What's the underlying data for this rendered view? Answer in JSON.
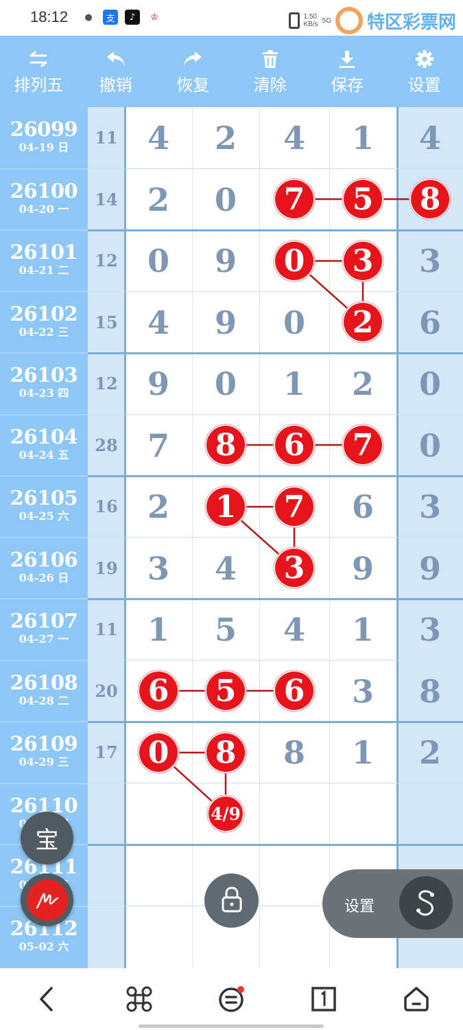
{
  "status_bar": {
    "time": "18:12",
    "speed_top": "1.50",
    "speed_unit": "KB/s",
    "network": "5G",
    "watermark": "特区彩票网"
  },
  "toolbar": {
    "items": [
      {
        "label": "排列五",
        "icon": "swap-arrows-icon"
      },
      {
        "label": "撤销",
        "icon": "undo-arrow-icon"
      },
      {
        "label": "恢复",
        "icon": "redo-arrow-icon"
      },
      {
        "label": "清除",
        "icon": "trash-icon"
      },
      {
        "label": "保存",
        "icon": "download-icon"
      },
      {
        "label": "设置",
        "icon": "gear-icon"
      }
    ]
  },
  "rows": [
    {
      "issue": "26099",
      "date": "04-19 日",
      "sum": "11",
      "digits": [
        "4",
        "2",
        "4",
        "1",
        "4"
      ]
    },
    {
      "issue": "26100",
      "date": "04-20 一",
      "sum": "14",
      "digits": [
        "2",
        "0",
        "7",
        "5",
        "8"
      ]
    },
    {
      "issue": "26101",
      "date": "04-21 二",
      "sum": "12",
      "digits": [
        "0",
        "9",
        "0",
        "3",
        "3"
      ]
    },
    {
      "issue": "26102",
      "date": "04-22 三",
      "sum": "15",
      "digits": [
        "4",
        "9",
        "0",
        "2",
        "6"
      ]
    },
    {
      "issue": "26103",
      "date": "04-23 四",
      "sum": "12",
      "digits": [
        "9",
        "0",
        "1",
        "2",
        "0"
      ]
    },
    {
      "issue": "26104",
      "date": "04-24 五",
      "sum": "28",
      "digits": [
        "7",
        "8",
        "6",
        "7",
        "0"
      ]
    },
    {
      "issue": "26105",
      "date": "04-25 六",
      "sum": "16",
      "digits": [
        "2",
        "1",
        "7",
        "6",
        "3"
      ]
    },
    {
      "issue": "26106",
      "date": "04-26 日",
      "sum": "19",
      "digits": [
        "3",
        "4",
        "3",
        "9",
        "9"
      ]
    },
    {
      "issue": "26107",
      "date": "04-27 一",
      "sum": "11",
      "digits": [
        "1",
        "5",
        "4",
        "1",
        "3"
      ]
    },
    {
      "issue": "26108",
      "date": "04-28 二",
      "sum": "20",
      "digits": [
        "6",
        "5",
        "6",
        "3",
        "8"
      ]
    },
    {
      "issue": "26109",
      "date": "04-29 三",
      "sum": "17",
      "digits": [
        "0",
        "8",
        "8",
        "1",
        "2"
      ]
    },
    {
      "issue": "26110",
      "date": "04-30 四",
      "sum": "",
      "digits": [
        "",
        "",
        "",
        "",
        ""
      ]
    },
    {
      "issue": "26111",
      "date": "05-01 五",
      "sum": "",
      "digits": [
        "",
        "",
        "",
        "",
        ""
      ]
    },
    {
      "issue": "26112",
      "date": "05-02 六",
      "sum": "",
      "digits": [
        "",
        "",
        "",
        "",
        ""
      ]
    }
  ],
  "markers": [
    {
      "row": 1,
      "col": 2,
      "text": "7"
    },
    {
      "row": 1,
      "col": 3,
      "text": "5"
    },
    {
      "row": 1,
      "col": 4,
      "text": "8"
    },
    {
      "row": 2,
      "col": 2,
      "text": "0"
    },
    {
      "row": 2,
      "col": 3,
      "text": "3"
    },
    {
      "row": 3,
      "col": 3,
      "text": "2"
    },
    {
      "row": 5,
      "col": 1,
      "text": "8"
    },
    {
      "row": 5,
      "col": 2,
      "text": "6"
    },
    {
      "row": 5,
      "col": 3,
      "text": "7"
    },
    {
      "row": 6,
      "col": 1,
      "text": "1"
    },
    {
      "row": 6,
      "col": 2,
      "text": "7"
    },
    {
      "row": 7,
      "col": 2,
      "text": "3"
    },
    {
      "row": 9,
      "col": 0,
      "text": "6"
    },
    {
      "row": 9,
      "col": 1,
      "text": "5"
    },
    {
      "row": 9,
      "col": 2,
      "text": "6"
    },
    {
      "row": 10,
      "col": 0,
      "text": "0"
    },
    {
      "row": 10,
      "col": 1,
      "text": "8"
    },
    {
      "row": 11,
      "col": 1,
      "text": "4/9",
      "small": true
    }
  ],
  "connectors": [
    [
      1,
      2,
      1,
      3
    ],
    [
      1,
      3,
      1,
      4
    ],
    [
      2,
      2,
      2,
      3
    ],
    [
      2,
      3,
      3,
      3
    ],
    [
      2,
      2,
      3,
      3
    ],
    [
      5,
      1,
      5,
      2
    ],
    [
      5,
      2,
      5,
      3
    ],
    [
      6,
      1,
      6,
      2
    ],
    [
      6,
      2,
      7,
      2
    ],
    [
      6,
      1,
      7,
      2
    ],
    [
      9,
      0,
      9,
      1
    ],
    [
      9,
      1,
      9,
      2
    ],
    [
      10,
      0,
      10,
      1
    ],
    [
      10,
      1,
      11,
      1
    ],
    [
      10,
      0,
      11,
      1
    ]
  ],
  "floating": {
    "bao_label": "宝",
    "settings_label": "设置",
    "pen_icon": "signature-icon",
    "lock_icon": "lock-icon",
    "s_icon": "s-logo-icon"
  },
  "colors": {
    "toolbar_bg": "#8ec7f5",
    "marker_red": "#e8141b",
    "digit_gray": "#7f96b5"
  }
}
